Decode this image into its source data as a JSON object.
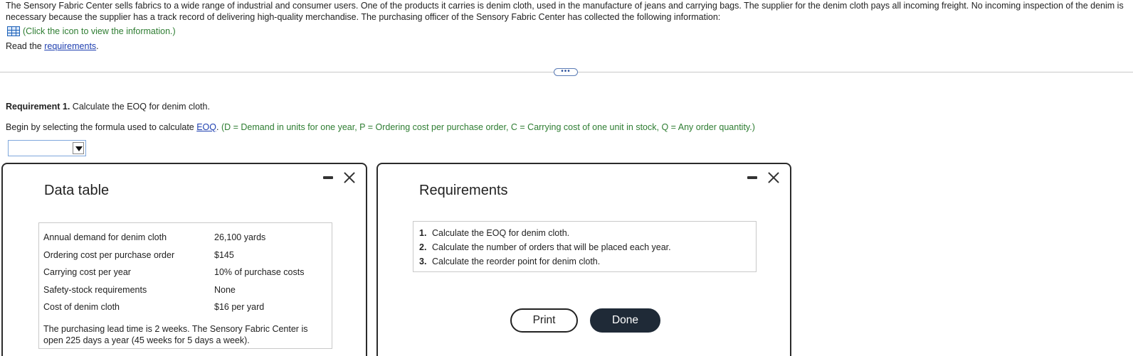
{
  "intro": {
    "text": "The Sensory Fabric Center sells fabrics to a wide range of industrial and consumer users. One of the products it carries is denim cloth, used in the manufacture of jeans and carrying bags. The supplier for the denim cloth pays all incoming freight. No incoming inspection of the denim is necessary because the supplier has a track record of delivering high-quality merchandise. The purchasing officer of the Sensory Fabric Center has collected the following information:",
    "info_link": "(Click the icon to view the information.)",
    "read_prefix": "Read the ",
    "requirements_link": "requirements",
    "read_suffix": "."
  },
  "expander": {
    "label": "•••"
  },
  "question": {
    "req_label": "Requirement 1.",
    "req_text": " Calculate the EOQ for denim cloth.",
    "begin_prefix": "Begin by selecting the formula used to calculate ",
    "eoq_link": "EOQ",
    "begin_dot": ". ",
    "definitions": "(D = Demand in units for one year, P = Ordering cost per purchase order, C = Carrying cost of one unit in stock, Q = Any order quantity.)",
    "dropdown_value": ""
  },
  "data_table": {
    "title": "Data table",
    "rows": [
      {
        "label": "Annual demand for denim cloth",
        "value": "26,100 yards"
      },
      {
        "label": "Ordering cost per purchase order",
        "value": "$145"
      },
      {
        "label": "Carrying cost per year",
        "value": "10% of purchase costs"
      },
      {
        "label": "Safety-stock requirements",
        "value": "None"
      },
      {
        "label": "Cost of denim cloth",
        "value": "$16 per yard"
      }
    ],
    "note": "The purchasing lead time is 2 weeks. The Sensory Fabric Center is open 225 days a year (45 weeks for 5 days a week)."
  },
  "requirements": {
    "title": "Requirements",
    "items": [
      {
        "num": "1.",
        "text": "Calculate the EOQ for denim cloth."
      },
      {
        "num": "2.",
        "text": "Calculate the number of orders that will be placed each year."
      },
      {
        "num": "3.",
        "text": "Calculate the reorder point for denim cloth."
      }
    ],
    "print_label": "Print",
    "done_label": "Done"
  },
  "colors": {
    "link": "#1e3fb0",
    "definitions": "#2e7d32",
    "done_button": "#1f2a37"
  }
}
